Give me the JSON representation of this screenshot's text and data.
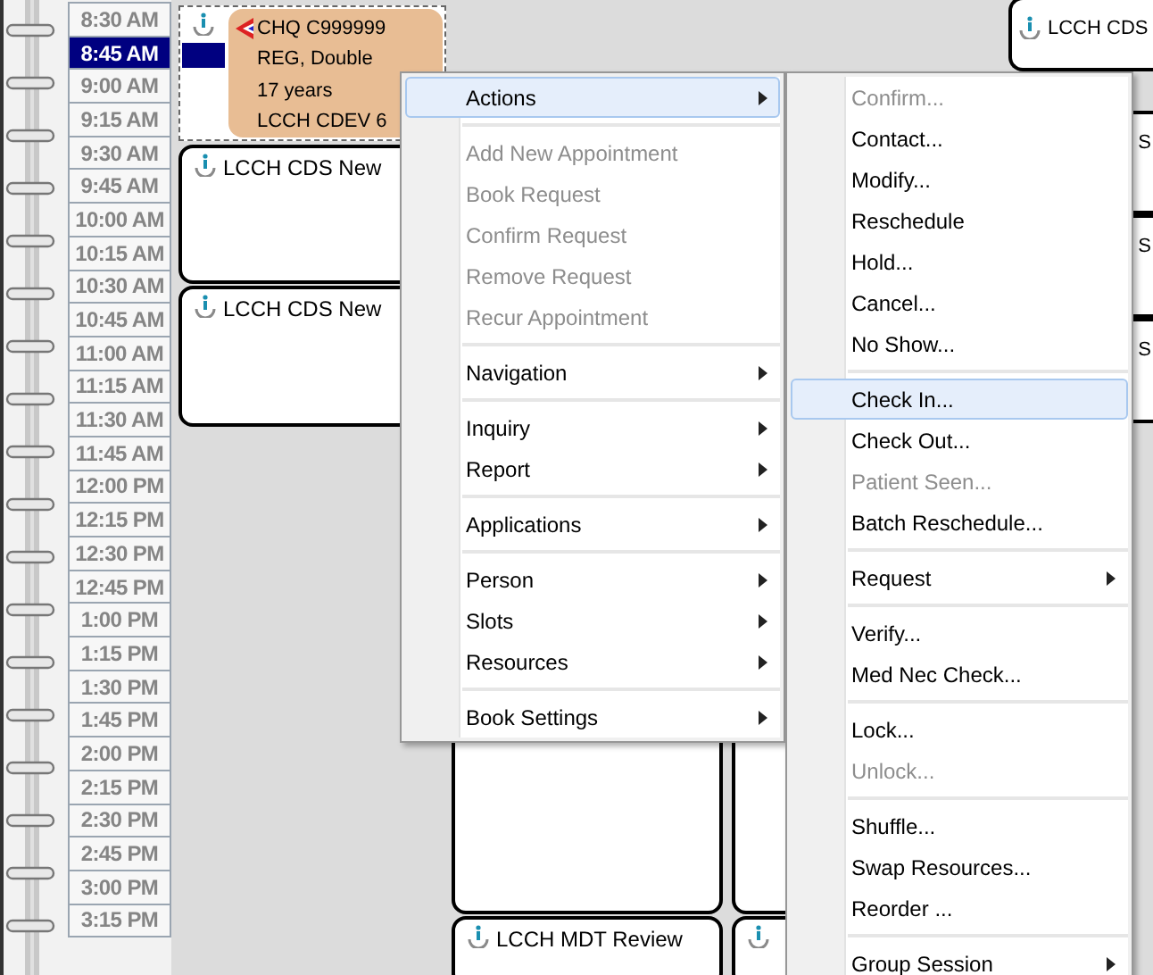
{
  "time_slots": [
    {
      "label": "8:30 AM",
      "selected": false
    },
    {
      "label": "8:45 AM",
      "selected": true
    },
    {
      "label": "9:00 AM",
      "selected": false
    },
    {
      "label": "9:15 AM",
      "selected": false
    },
    {
      "label": "9:30 AM",
      "selected": false
    },
    {
      "label": "9:45 AM",
      "selected": false
    },
    {
      "label": "10:00 AM",
      "selected": false
    },
    {
      "label": "10:15 AM",
      "selected": false
    },
    {
      "label": "10:30 AM",
      "selected": false
    },
    {
      "label": "10:45 AM",
      "selected": false
    },
    {
      "label": "11:00 AM",
      "selected": false
    },
    {
      "label": "11:15 AM",
      "selected": false
    },
    {
      "label": "11:30 AM",
      "selected": false
    },
    {
      "label": "11:45 AM",
      "selected": false
    },
    {
      "label": "12:00 PM",
      "selected": false
    },
    {
      "label": "12:15 PM",
      "selected": false
    },
    {
      "label": "12:30 PM",
      "selected": false
    },
    {
      "label": "12:45 PM",
      "selected": false
    },
    {
      "label": "1:00 PM",
      "selected": false
    },
    {
      "label": "1:15 PM",
      "selected": false
    },
    {
      "label": "1:30 PM",
      "selected": false
    },
    {
      "label": "1:45 PM",
      "selected": false
    },
    {
      "label": "2:00 PM",
      "selected": false
    },
    {
      "label": "2:15 PM",
      "selected": false
    },
    {
      "label": "2:30 PM",
      "selected": false
    },
    {
      "label": "2:45 PM",
      "selected": false
    },
    {
      "label": "3:00 PM",
      "selected": false
    },
    {
      "label": "3:15 PM",
      "selected": false
    }
  ],
  "appointments": [
    {
      "kind": "patient",
      "lines": [
        "CHQ C999999",
        "REG, Double",
        "17 years",
        "LCCH CDEV 6"
      ]
    },
    {
      "kind": "slot",
      "title": "LCCH CDS New"
    },
    {
      "kind": "slot",
      "title": "LCCH CDS New"
    },
    {
      "kind": "empty"
    },
    {
      "kind": "slot",
      "title": "LCCH MDT Review"
    },
    {
      "kind": "empty"
    },
    {
      "kind": "slot"
    },
    {
      "kind": "slot",
      "title": "LCCH CDS"
    },
    {
      "kind": "slot",
      "title": "S"
    },
    {
      "kind": "slot",
      "title": "S"
    },
    {
      "kind": "slot",
      "title": "S"
    }
  ],
  "context_menu": {
    "groups": [
      [
        {
          "label": "Actions",
          "submenu": true,
          "disabled": false,
          "selected": true
        }
      ],
      [
        {
          "label": "Add New Appointment",
          "submenu": false,
          "disabled": true,
          "selected": false
        },
        {
          "label": "Book Request",
          "submenu": false,
          "disabled": true,
          "selected": false
        },
        {
          "label": "Confirm Request",
          "submenu": false,
          "disabled": true,
          "selected": false
        },
        {
          "label": "Remove Request",
          "submenu": false,
          "disabled": true,
          "selected": false
        },
        {
          "label": "Recur Appointment",
          "submenu": false,
          "disabled": true,
          "selected": false
        }
      ],
      [
        {
          "label": "Navigation",
          "submenu": true,
          "disabled": false,
          "selected": false
        }
      ],
      [
        {
          "label": "Inquiry",
          "submenu": true,
          "disabled": false,
          "selected": false
        },
        {
          "label": "Report",
          "submenu": true,
          "disabled": false,
          "selected": false
        }
      ],
      [
        {
          "label": "Applications",
          "submenu": true,
          "disabled": false,
          "selected": false
        }
      ],
      [
        {
          "label": "Person",
          "submenu": true,
          "disabled": false,
          "selected": false
        },
        {
          "label": "Slots",
          "submenu": true,
          "disabled": false,
          "selected": false
        },
        {
          "label": "Resources",
          "submenu": true,
          "disabled": false,
          "selected": false
        }
      ],
      [
        {
          "label": "Book Settings",
          "submenu": true,
          "disabled": false,
          "selected": false
        }
      ]
    ]
  },
  "actions_submenu": {
    "groups": [
      [
        {
          "label": "Confirm...",
          "submenu": false,
          "disabled": true,
          "selected": false
        },
        {
          "label": "Contact...",
          "submenu": false,
          "disabled": false,
          "selected": false
        },
        {
          "label": "Modify...",
          "submenu": false,
          "disabled": false,
          "selected": false
        },
        {
          "label": "Reschedule",
          "submenu": false,
          "disabled": false,
          "selected": false
        },
        {
          "label": "Hold...",
          "submenu": false,
          "disabled": false,
          "selected": false
        },
        {
          "label": "Cancel...",
          "submenu": false,
          "disabled": false,
          "selected": false
        },
        {
          "label": "No Show...",
          "submenu": false,
          "disabled": false,
          "selected": false
        }
      ],
      [
        {
          "label": "Check In...",
          "submenu": false,
          "disabled": false,
          "selected": true
        },
        {
          "label": "Check Out...",
          "submenu": false,
          "disabled": false,
          "selected": false
        },
        {
          "label": "Patient Seen...",
          "submenu": false,
          "disabled": true,
          "selected": false
        },
        {
          "label": "Batch Reschedule...",
          "submenu": false,
          "disabled": false,
          "selected": false
        }
      ],
      [
        {
          "label": "Request",
          "submenu": true,
          "disabled": false,
          "selected": false
        }
      ],
      [
        {
          "label": "Verify...",
          "submenu": false,
          "disabled": false,
          "selected": false
        },
        {
          "label": "Med Nec Check...",
          "submenu": false,
          "disabled": false,
          "selected": false
        }
      ],
      [
        {
          "label": "Lock...",
          "submenu": false,
          "disabled": false,
          "selected": false
        },
        {
          "label": "Unlock...",
          "submenu": false,
          "disabled": true,
          "selected": false
        }
      ],
      [
        {
          "label": "Shuffle...",
          "submenu": false,
          "disabled": false,
          "selected": false
        },
        {
          "label": "Swap Resources...",
          "submenu": false,
          "disabled": false,
          "selected": false
        },
        {
          "label": "Reorder ...",
          "submenu": false,
          "disabled": false,
          "selected": false
        }
      ],
      [
        {
          "label": "Group Session",
          "submenu": true,
          "disabled": false,
          "selected": false
        }
      ]
    ]
  }
}
